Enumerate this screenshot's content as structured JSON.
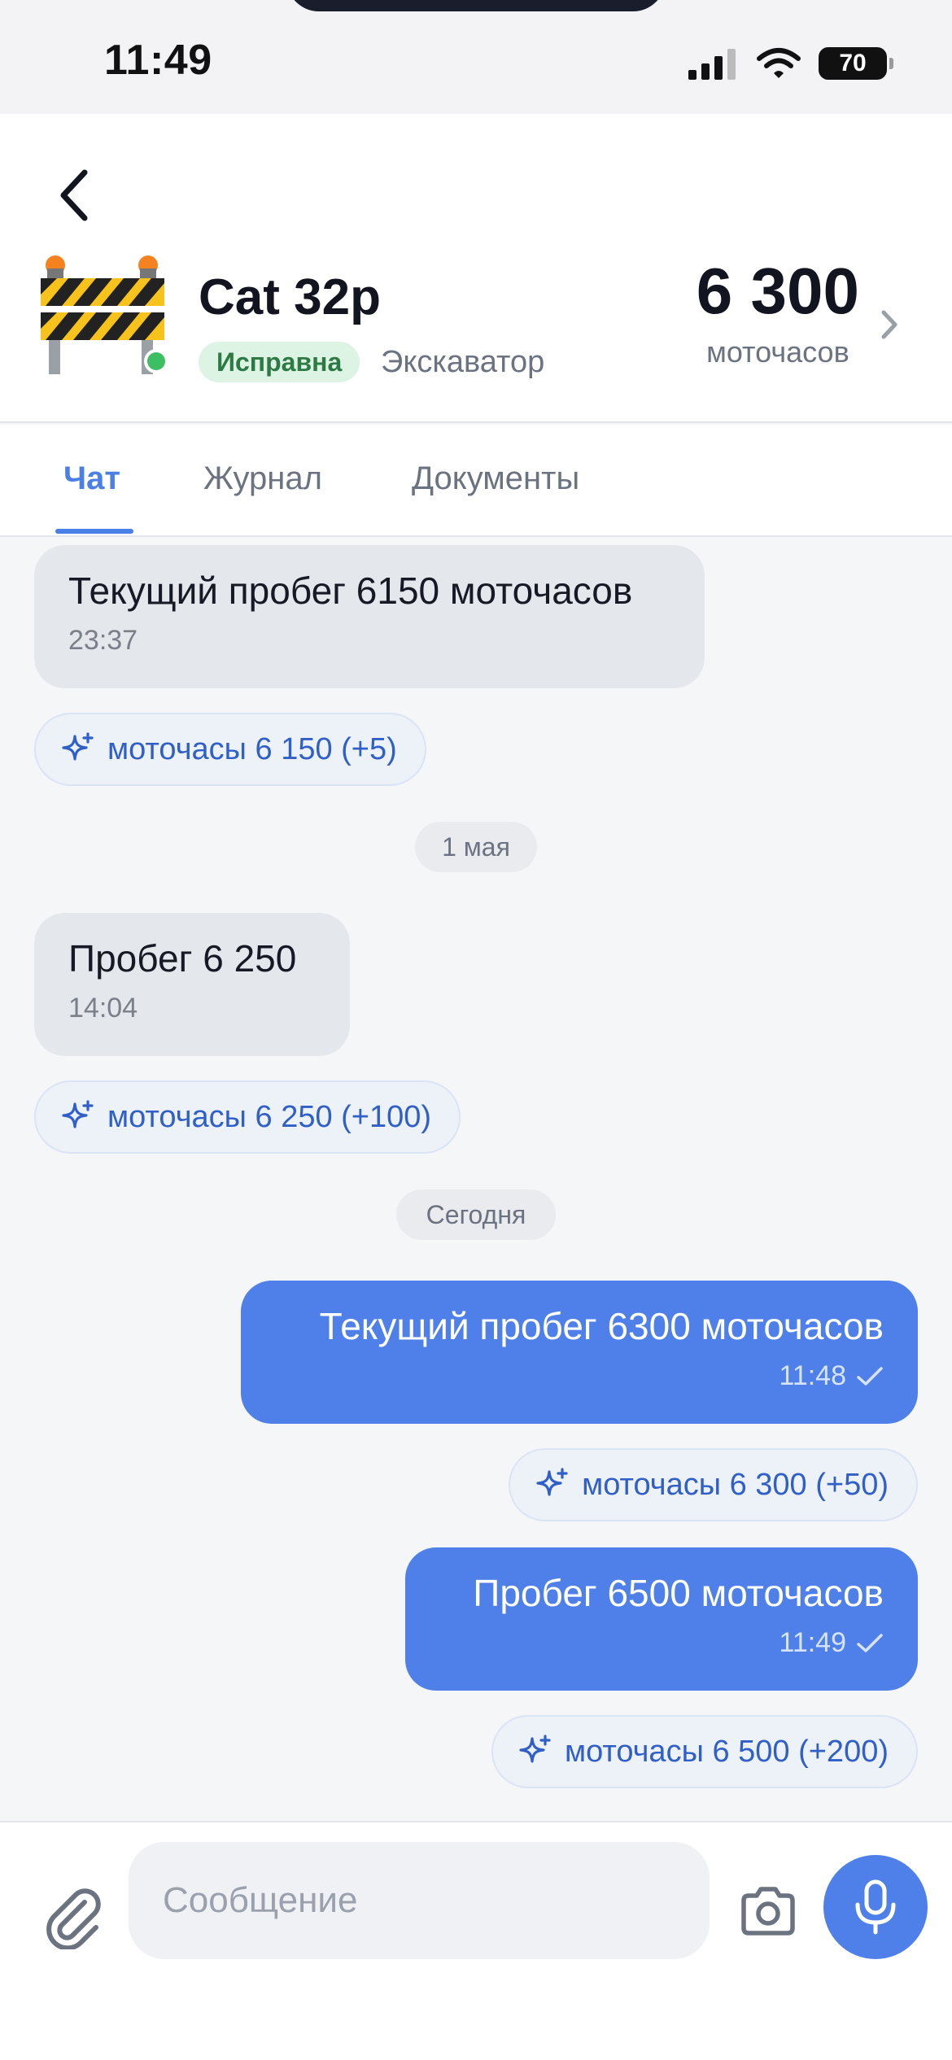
{
  "status_bar": {
    "time": "11:49",
    "battery": "70"
  },
  "equipment": {
    "name": "Cat 32p",
    "status": "Исправна",
    "type": "Экскаватор",
    "hours_value": "6 300",
    "hours_unit": "моточасов"
  },
  "tabs": [
    {
      "label": "Чат",
      "active": true
    },
    {
      "label": "Журнал",
      "active": false
    },
    {
      "label": "Документы",
      "active": false
    }
  ],
  "messages": {
    "m1": {
      "text": "Текущий пробег 6150 моточасов",
      "time": "23:37",
      "chip": "моточасы 6 150 (+5)"
    },
    "date1": "1 мая",
    "m2": {
      "text": "Пробег 6 250",
      "time": "14:04",
      "chip": "моточасы 6 250 (+100)"
    },
    "date2": "Сегодня",
    "m3": {
      "text": "Текущий пробег 6300 моточасов",
      "time": "11:48",
      "chip": "моточасы 6 300 (+50)"
    },
    "m4": {
      "text": "Пробег 6500 моточасов",
      "time": "11:49",
      "chip": "моточасы 6 500 (+200)"
    }
  },
  "composer": {
    "placeholder": "Сообщение"
  },
  "colors": {
    "accent": "#4f80ea",
    "status_ok_bg": "#ddf3e4",
    "status_ok_text": "#2d7a45"
  }
}
